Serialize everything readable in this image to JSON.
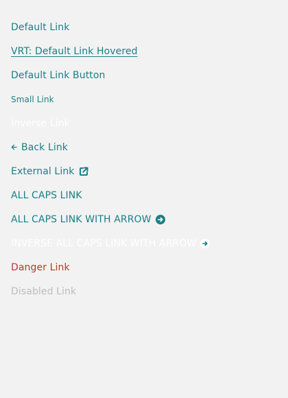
{
  "links": {
    "default": "Default Link",
    "hovered": "VRT: Default Link Hovered",
    "button": "Default Link Button",
    "small": "Small Link",
    "inverse": "Inverse Link",
    "back": "Back Link",
    "external": "External Link",
    "all_caps": "ALL CAPS LINK",
    "all_caps_arrow": "ALL CAPS LINK WITH ARROW",
    "inverse_all_caps_arrow": "INVERSE ALL CAPS LINK WITH ARROW",
    "danger": "Danger Link",
    "disabled": "Disabled Link"
  },
  "colors": {
    "link": "#1a7f86",
    "inverse": "#ffffff",
    "danger": "#b23b28",
    "disabled": "#bcbcbc",
    "background": "#f2f2f2"
  },
  "icons": {
    "back": "arrow-left-icon",
    "external": "external-link-icon",
    "arrow_circle": "arrow-right-circle-icon"
  }
}
